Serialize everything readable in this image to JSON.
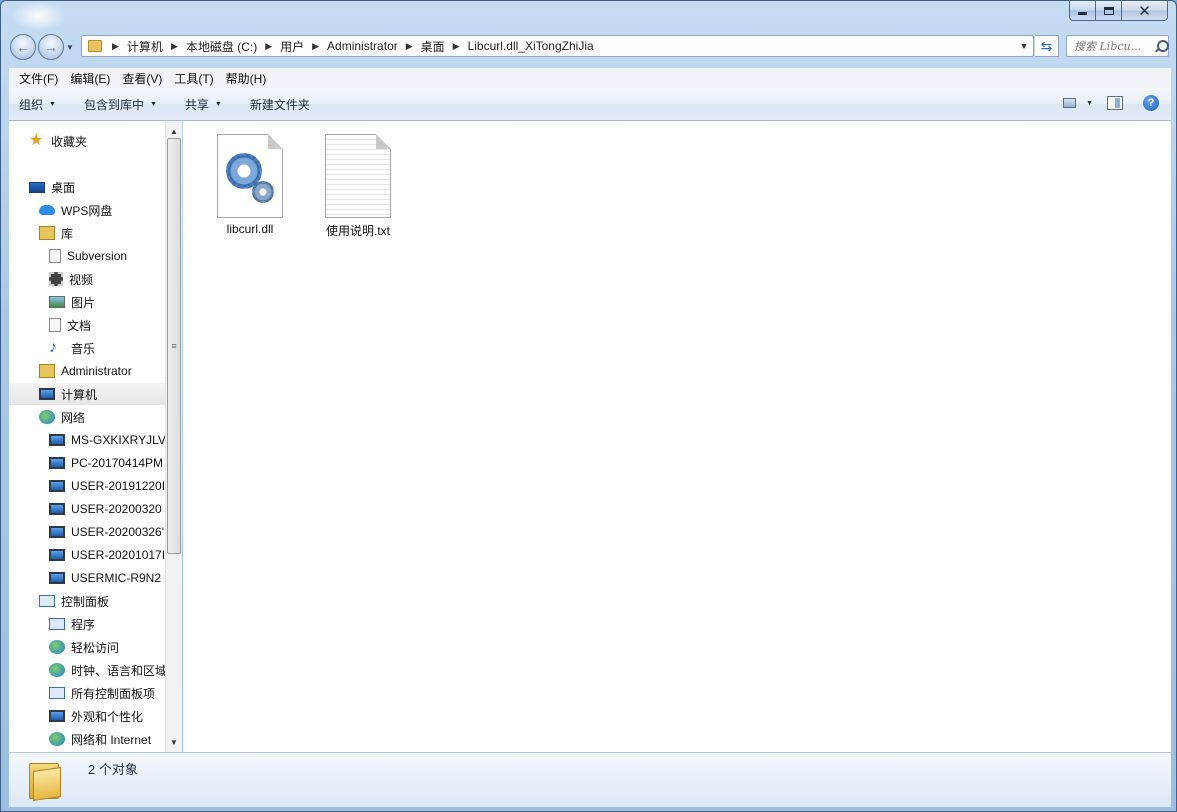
{
  "window": {
    "caption_buttons": {
      "minimize": "minimize",
      "maximize": "maximize",
      "close": "✕"
    }
  },
  "address": {
    "crumbs": [
      "计算机",
      "本地磁盘 (C:)",
      "用户",
      "Administrator",
      "桌面",
      "Libcurl.dll_XiTongZhiJia"
    ]
  },
  "search": {
    "placeholder": "搜索 Libcu..."
  },
  "menubar": {
    "items": [
      "文件(F)",
      "编辑(E)",
      "查看(V)",
      "工具(T)",
      "帮助(H)"
    ]
  },
  "toolbar": {
    "organize": "组织",
    "include_library": "包含到库中",
    "share": "共享",
    "new_folder": "新建文件夹"
  },
  "navpane": {
    "favorites": "收藏夹",
    "desktop": "桌面",
    "wps": "WPS网盘",
    "library": "库",
    "subversion": "Subversion",
    "videos": "视频",
    "pictures": "图片",
    "documents": "文档",
    "music": "音乐",
    "administrator": "Administrator",
    "computer": "计算机",
    "network": "网络",
    "net_items": [
      "MS-GXKIXRYJLV",
      "PC-20170414PM",
      "USER-20191220I",
      "USER-20200320",
      "USER-20200326'",
      "USER-20201017I",
      "USERMIC-R9N2"
    ],
    "control_panel": "控制面板",
    "cp_items": [
      "程序",
      "轻松访问",
      "时钟、语言和区域",
      "所有控制面板项",
      "外观和个性化",
      "网络和 Internet"
    ]
  },
  "files": [
    {
      "name": "libcurl.dll",
      "icon": "dll-gear-icon"
    },
    {
      "name": "使用说明.txt",
      "icon": "text-file-icon"
    }
  ],
  "status": {
    "count": "2 个对象"
  }
}
